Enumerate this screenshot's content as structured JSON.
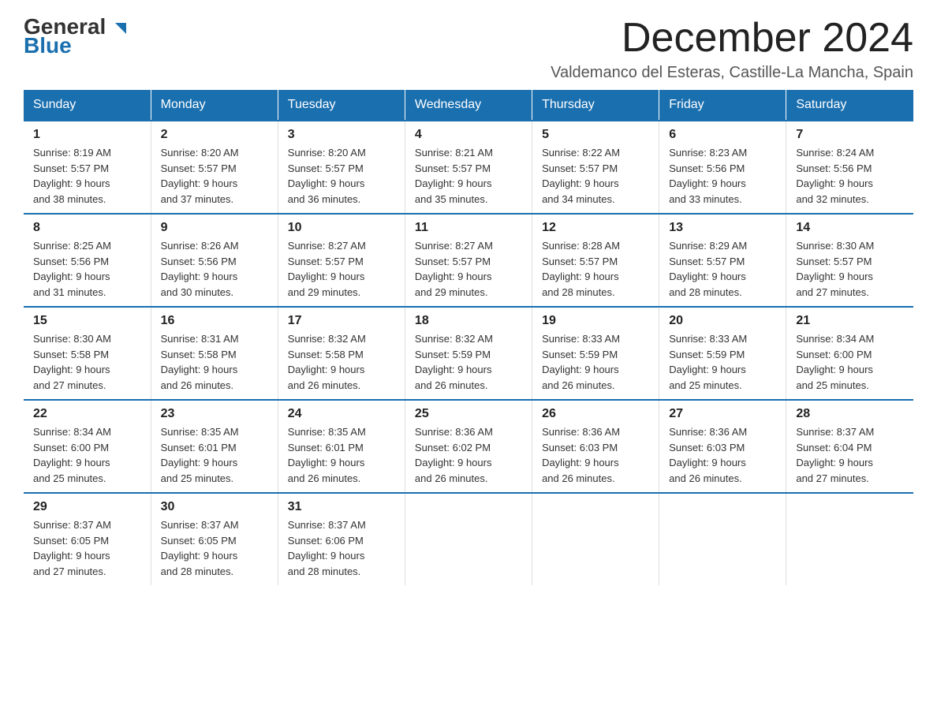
{
  "header": {
    "logo_general": "General",
    "logo_blue": "Blue",
    "main_title": "December 2024",
    "subtitle": "Valdemanco del Esteras, Castille-La Mancha, Spain"
  },
  "days_of_week": [
    "Sunday",
    "Monday",
    "Tuesday",
    "Wednesday",
    "Thursday",
    "Friday",
    "Saturday"
  ],
  "weeks": [
    [
      {
        "day": "1",
        "sunrise": "8:19 AM",
        "sunset": "5:57 PM",
        "daylight": "9 hours and 38 minutes."
      },
      {
        "day": "2",
        "sunrise": "8:20 AM",
        "sunset": "5:57 PM",
        "daylight": "9 hours and 37 minutes."
      },
      {
        "day": "3",
        "sunrise": "8:20 AM",
        "sunset": "5:57 PM",
        "daylight": "9 hours and 36 minutes."
      },
      {
        "day": "4",
        "sunrise": "8:21 AM",
        "sunset": "5:57 PM",
        "daylight": "9 hours and 35 minutes."
      },
      {
        "day": "5",
        "sunrise": "8:22 AM",
        "sunset": "5:57 PM",
        "daylight": "9 hours and 34 minutes."
      },
      {
        "day": "6",
        "sunrise": "8:23 AM",
        "sunset": "5:56 PM",
        "daylight": "9 hours and 33 minutes."
      },
      {
        "day": "7",
        "sunrise": "8:24 AM",
        "sunset": "5:56 PM",
        "daylight": "9 hours and 32 minutes."
      }
    ],
    [
      {
        "day": "8",
        "sunrise": "8:25 AM",
        "sunset": "5:56 PM",
        "daylight": "9 hours and 31 minutes."
      },
      {
        "day": "9",
        "sunrise": "8:26 AM",
        "sunset": "5:56 PM",
        "daylight": "9 hours and 30 minutes."
      },
      {
        "day": "10",
        "sunrise": "8:27 AM",
        "sunset": "5:57 PM",
        "daylight": "9 hours and 29 minutes."
      },
      {
        "day": "11",
        "sunrise": "8:27 AM",
        "sunset": "5:57 PM",
        "daylight": "9 hours and 29 minutes."
      },
      {
        "day": "12",
        "sunrise": "8:28 AM",
        "sunset": "5:57 PM",
        "daylight": "9 hours and 28 minutes."
      },
      {
        "day": "13",
        "sunrise": "8:29 AM",
        "sunset": "5:57 PM",
        "daylight": "9 hours and 28 minutes."
      },
      {
        "day": "14",
        "sunrise": "8:30 AM",
        "sunset": "5:57 PM",
        "daylight": "9 hours and 27 minutes."
      }
    ],
    [
      {
        "day": "15",
        "sunrise": "8:30 AM",
        "sunset": "5:58 PM",
        "daylight": "9 hours and 27 minutes."
      },
      {
        "day": "16",
        "sunrise": "8:31 AM",
        "sunset": "5:58 PM",
        "daylight": "9 hours and 26 minutes."
      },
      {
        "day": "17",
        "sunrise": "8:32 AM",
        "sunset": "5:58 PM",
        "daylight": "9 hours and 26 minutes."
      },
      {
        "day": "18",
        "sunrise": "8:32 AM",
        "sunset": "5:59 PM",
        "daylight": "9 hours and 26 minutes."
      },
      {
        "day": "19",
        "sunrise": "8:33 AM",
        "sunset": "5:59 PM",
        "daylight": "9 hours and 26 minutes."
      },
      {
        "day": "20",
        "sunrise": "8:33 AM",
        "sunset": "5:59 PM",
        "daylight": "9 hours and 25 minutes."
      },
      {
        "day": "21",
        "sunrise": "8:34 AM",
        "sunset": "6:00 PM",
        "daylight": "9 hours and 25 minutes."
      }
    ],
    [
      {
        "day": "22",
        "sunrise": "8:34 AM",
        "sunset": "6:00 PM",
        "daylight": "9 hours and 25 minutes."
      },
      {
        "day": "23",
        "sunrise": "8:35 AM",
        "sunset": "6:01 PM",
        "daylight": "9 hours and 25 minutes."
      },
      {
        "day": "24",
        "sunrise": "8:35 AM",
        "sunset": "6:01 PM",
        "daylight": "9 hours and 26 minutes."
      },
      {
        "day": "25",
        "sunrise": "8:36 AM",
        "sunset": "6:02 PM",
        "daylight": "9 hours and 26 minutes."
      },
      {
        "day": "26",
        "sunrise": "8:36 AM",
        "sunset": "6:03 PM",
        "daylight": "9 hours and 26 minutes."
      },
      {
        "day": "27",
        "sunrise": "8:36 AM",
        "sunset": "6:03 PM",
        "daylight": "9 hours and 26 minutes."
      },
      {
        "day": "28",
        "sunrise": "8:37 AM",
        "sunset": "6:04 PM",
        "daylight": "9 hours and 27 minutes."
      }
    ],
    [
      {
        "day": "29",
        "sunrise": "8:37 AM",
        "sunset": "6:05 PM",
        "daylight": "9 hours and 27 minutes."
      },
      {
        "day": "30",
        "sunrise": "8:37 AM",
        "sunset": "6:05 PM",
        "daylight": "9 hours and 28 minutes."
      },
      {
        "day": "31",
        "sunrise": "8:37 AM",
        "sunset": "6:06 PM",
        "daylight": "9 hours and 28 minutes."
      },
      null,
      null,
      null,
      null
    ]
  ],
  "labels": {
    "sunrise": "Sunrise:",
    "sunset": "Sunset:",
    "daylight": "Daylight:"
  }
}
